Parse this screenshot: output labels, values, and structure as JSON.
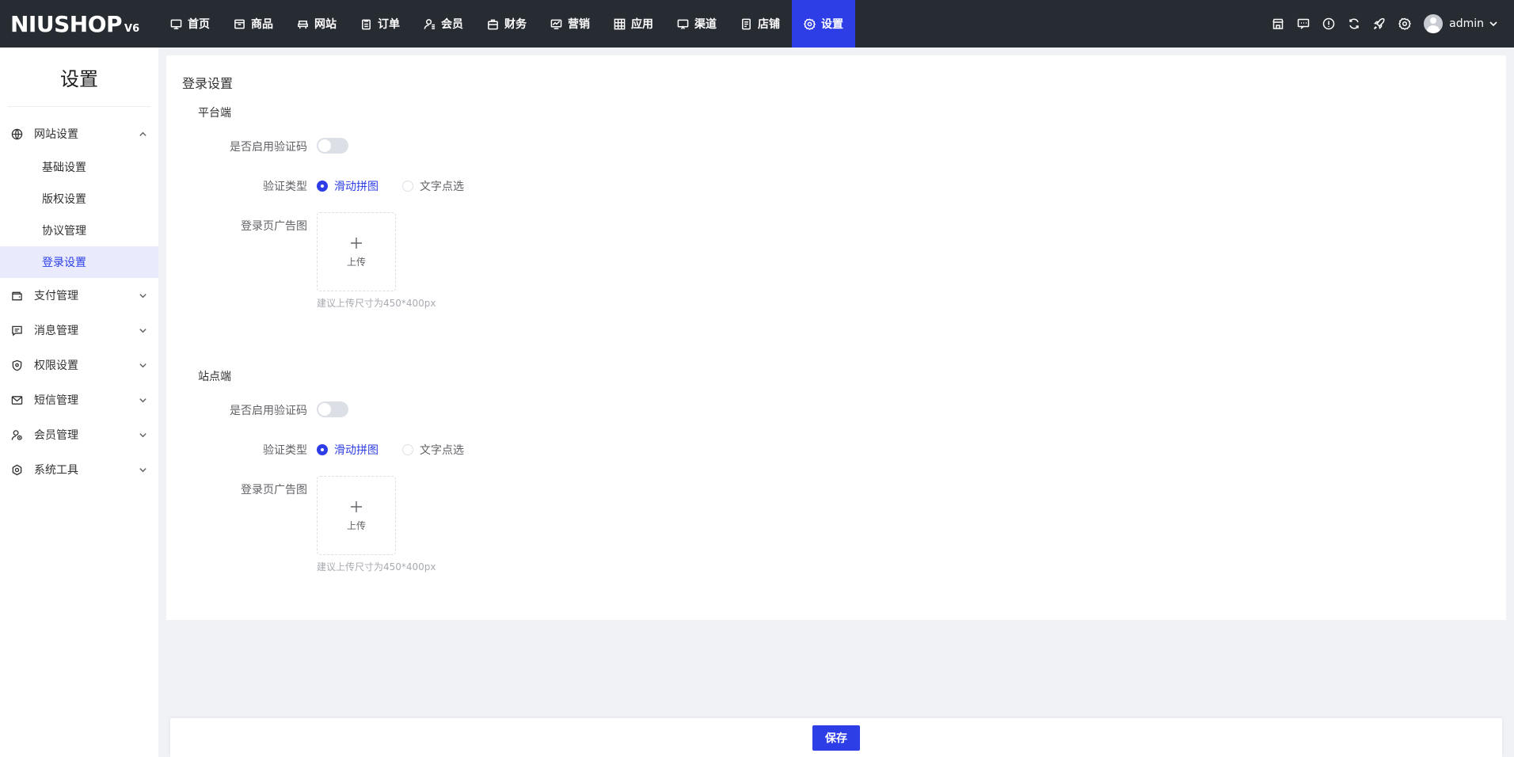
{
  "logo": {
    "text": "NIUSHOP",
    "version": "V6"
  },
  "nav": [
    {
      "label": "首页",
      "icon": "monitor-icon"
    },
    {
      "label": "商品",
      "icon": "box-icon"
    },
    {
      "label": "网站",
      "icon": "chair-icon"
    },
    {
      "label": "订单",
      "icon": "clipboard-icon"
    },
    {
      "label": "会员",
      "icon": "user-icon"
    },
    {
      "label": "财务",
      "icon": "briefcase-icon"
    },
    {
      "label": "营销",
      "icon": "screen-icon"
    },
    {
      "label": "应用",
      "icon": "grid-icon"
    },
    {
      "label": "渠道",
      "icon": "display-icon"
    },
    {
      "label": "店铺",
      "icon": "document-icon"
    },
    {
      "label": "设置",
      "icon": "gear-icon",
      "active": true
    }
  ],
  "user": {
    "name": "admin"
  },
  "sidebar": {
    "title": "设置",
    "menus": [
      {
        "label": "网站设置",
        "icon": "globe-icon",
        "expanded": true,
        "items": [
          "基础设置",
          "版权设置",
          "协议管理",
          "登录设置"
        ],
        "active_item": "登录设置"
      },
      {
        "label": "支付管理",
        "icon": "wallet-icon"
      },
      {
        "label": "消息管理",
        "icon": "message-icon"
      },
      {
        "label": "权限设置",
        "icon": "shield-icon"
      },
      {
        "label": "短信管理",
        "icon": "mail-icon"
      },
      {
        "label": "会员管理",
        "icon": "member-icon"
      },
      {
        "label": "系统工具",
        "icon": "tool-icon"
      }
    ]
  },
  "panel": {
    "title": "登录设置",
    "sections": [
      {
        "title": "平台端",
        "captcha_label": "是否启用验证码",
        "captcha_enabled": false,
        "type_label": "验证类型",
        "type_options": [
          "滑动拼图",
          "文字点选"
        ],
        "type_selected": "滑动拼图",
        "ad_label": "登录页广告图",
        "upload_text": "上传",
        "hint": "建议上传尺寸为450*400px"
      },
      {
        "title": "站点端",
        "captcha_label": "是否启用验证码",
        "captcha_enabled": false,
        "type_label": "验证类型",
        "type_options": [
          "滑动拼图",
          "文字点选"
        ],
        "type_selected": "滑动拼图",
        "ad_label": "登录页广告图",
        "upload_text": "上传",
        "hint": "建议上传尺寸为450*400px"
      }
    ]
  },
  "footer": {
    "save_label": "保存"
  },
  "colors": {
    "accent": "#2d3ee6",
    "topbar": "#272c33",
    "background": "#f0f2f5"
  }
}
